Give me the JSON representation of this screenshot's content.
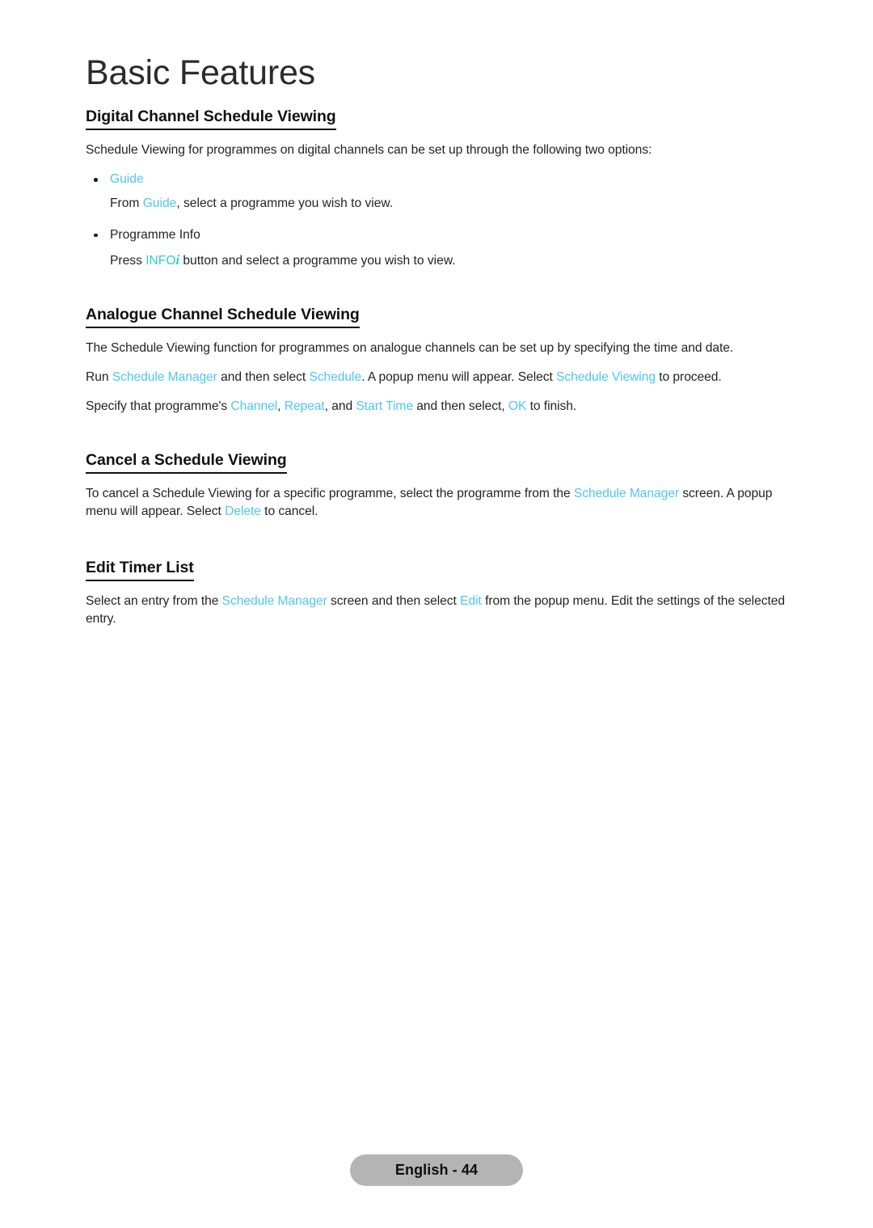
{
  "document": {
    "chapter_title": "Basic Features",
    "page_badge": "English - 44"
  },
  "sections": [
    {
      "heading": "Digital Channel Schedule Viewing",
      "intro": "Schedule Viewing for programmes on digital channels can be set up through the following two options:",
      "bullets": [
        {
          "label": "Guide",
          "label_color": "#4cc6f4",
          "detail_pre": "From ",
          "detail_term": "Guide",
          "detail_post": ", select a programme you wish to view."
        },
        {
          "label": "Programme Info",
          "label_color": "#232323",
          "detail_pre": "Press ",
          "detail_term": "INFO",
          "detail_term_italic": "i",
          "detail_post": " button and select a programme you wish to view."
        }
      ]
    },
    {
      "heading": "Analogue Channel Schedule Viewing",
      "paragraphs": [
        {
          "p1": "The Schedule Viewing function for programmes on analogue channels can be set up by specifying the time and date."
        },
        {
          "run_pre": "Run ",
          "term1": "Schedule Manager",
          "mid1": " and then select ",
          "term2": "Schedule",
          "mid2": ". A popup menu will appear. Select ",
          "term3": "Schedule Viewing",
          "post": " to proceed."
        },
        {
          "spec_pre": "Specify that programme's ",
          "term1": "Channel",
          "sep1": ", ",
          "term2": "Repeat",
          "sep2": ", and ",
          "term3": "Start Time",
          "mid": " and then select, ",
          "term4": "OK",
          "post": " to finish."
        }
      ]
    },
    {
      "heading": "Cancel a Schedule Viewing",
      "paragraph": {
        "pre": "To cancel a Schedule Viewing for a specific programme, select the programme from the ",
        "term1": "Schedule Manager",
        "mid": " screen. A popup menu will appear. Select ",
        "term2": "Delete",
        "post": " to cancel."
      }
    },
    {
      "heading": "Edit Timer List",
      "paragraph": {
        "pre": "Select an entry from the ",
        "term1": "Schedule Manager",
        "mid": " screen and then select ",
        "term2": "Edit",
        "post": " from the popup menu. Edit the settings of the selected entry."
      }
    }
  ],
  "colors": {
    "menu_term": "#4cc6f4",
    "info_term": "#2ecfc2",
    "badge_background": "#b4b4b4",
    "text": "#232323"
  }
}
